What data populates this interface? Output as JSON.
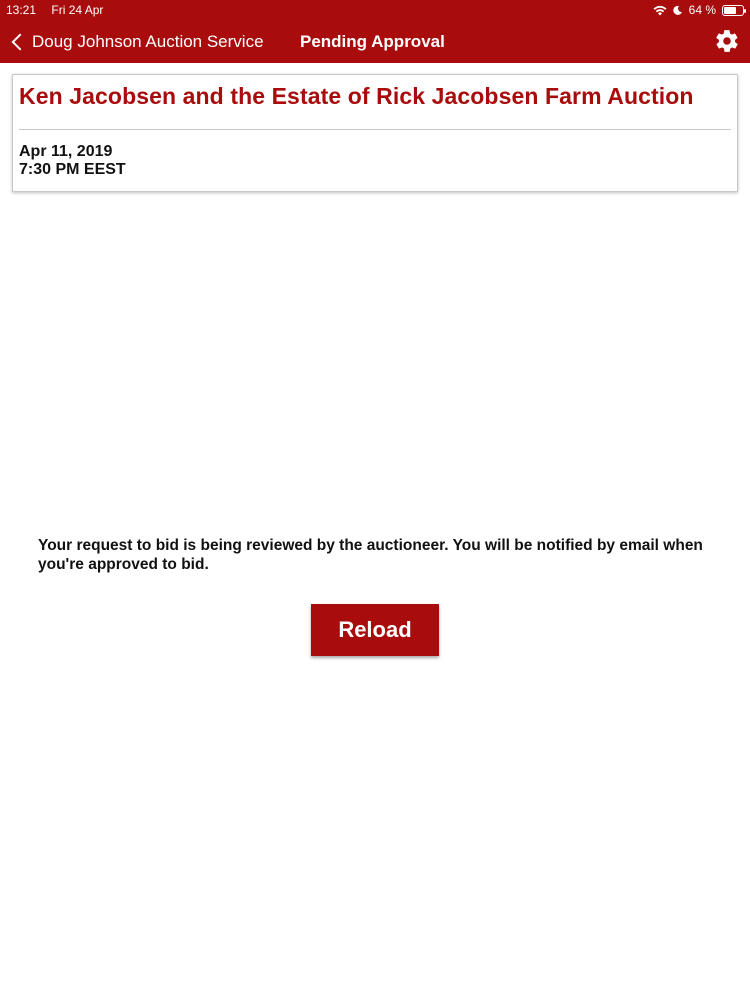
{
  "status_bar": {
    "time": "13:21",
    "date": "Fri 24 Apr",
    "battery_percent": "64 %",
    "battery_level": 0.64
  },
  "nav": {
    "back_label": "Doug Johnson Auction Service",
    "title": "Pending Approval",
    "settings_icon": "gear-icon"
  },
  "auction": {
    "title": "Ken Jacobsen and the Estate of Rick Jacobsen Farm Auction",
    "date": "Apr 11, 2019",
    "time": "7:30 PM EEST"
  },
  "message": "Your request to bid is being reviewed by the auctioneer. You will be notified by email when you're approved to bid.",
  "reload_label": "Reload",
  "colors": {
    "brand_red": "#a80c0c"
  }
}
